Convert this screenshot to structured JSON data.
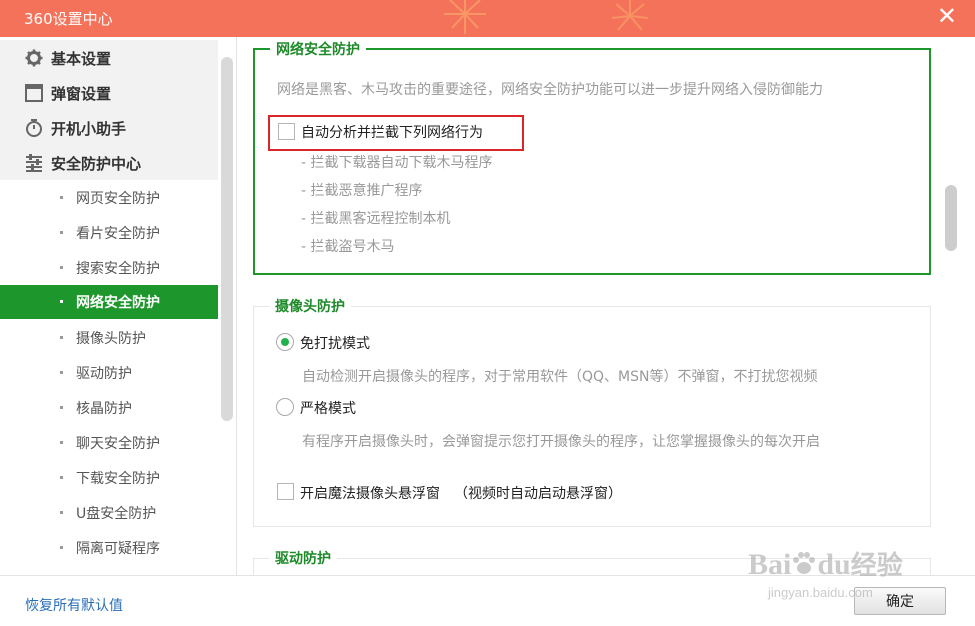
{
  "window": {
    "title": "360设置中心"
  },
  "colors": {
    "titlebar": "#f5725a",
    "accent_green": "#1d962b",
    "highlight_red": "#d8262b"
  },
  "sidebar": {
    "top_items": [
      {
        "label": "基本设置",
        "icon": "gear-icon"
      },
      {
        "label": "弹窗设置",
        "icon": "window-icon"
      },
      {
        "label": "开机小助手",
        "icon": "timer-icon"
      },
      {
        "label": "安全防护中心",
        "icon": "shield-list-icon"
      }
    ],
    "sub_items": [
      {
        "label": "网页安全防护"
      },
      {
        "label": "看片安全防护"
      },
      {
        "label": "搜索安全防护"
      },
      {
        "label": "网络安全防护",
        "active": true
      },
      {
        "label": "摄像头防护"
      },
      {
        "label": "驱动防护"
      },
      {
        "label": "核晶防护"
      },
      {
        "label": "聊天安全防护"
      },
      {
        "label": "下载安全防护"
      },
      {
        "label": "U盘安全防护"
      },
      {
        "label": "隔离可疑程序"
      }
    ]
  },
  "network": {
    "title": "网络安全防护",
    "description": "网络是黑客、木马攻击的重要途径，网络安全防护功能可以进一步提升网络入侵防御能力",
    "checkbox_label": "自动分析并拦截下列网络行为",
    "checked": false,
    "items": [
      "- 拦截下载器自动下载木马程序",
      "- 拦截恶意推广程序",
      "- 拦截黑客远程控制本机",
      "- 拦截盗号木马"
    ]
  },
  "camera": {
    "title": "摄像头防护",
    "mode1_label": "免打扰模式",
    "mode1_desc": "自动检测开启摄像头的程序，对于常用软件（QQ、MSN等）不弹窗，不打扰您视频",
    "mode2_label": "严格模式",
    "mode2_desc": "有程序开启摄像头时，会弹窗提示您打开摄像头的程序，让您掌握摄像头的每次开启",
    "selected_mode": "免打扰模式",
    "float_label": "开启魔法摄像头悬浮窗",
    "float_note": "（视频时自动启动悬浮窗）",
    "float_checked": false
  },
  "driver": {
    "title": "驱动防护"
  },
  "footer": {
    "restore_label": "恢复所有默认值",
    "ok_label": "确定"
  },
  "watermark": {
    "brand": "Bai",
    "brand2": "du",
    "suffix": "经验",
    "url": "jingyan.baidu.com"
  }
}
